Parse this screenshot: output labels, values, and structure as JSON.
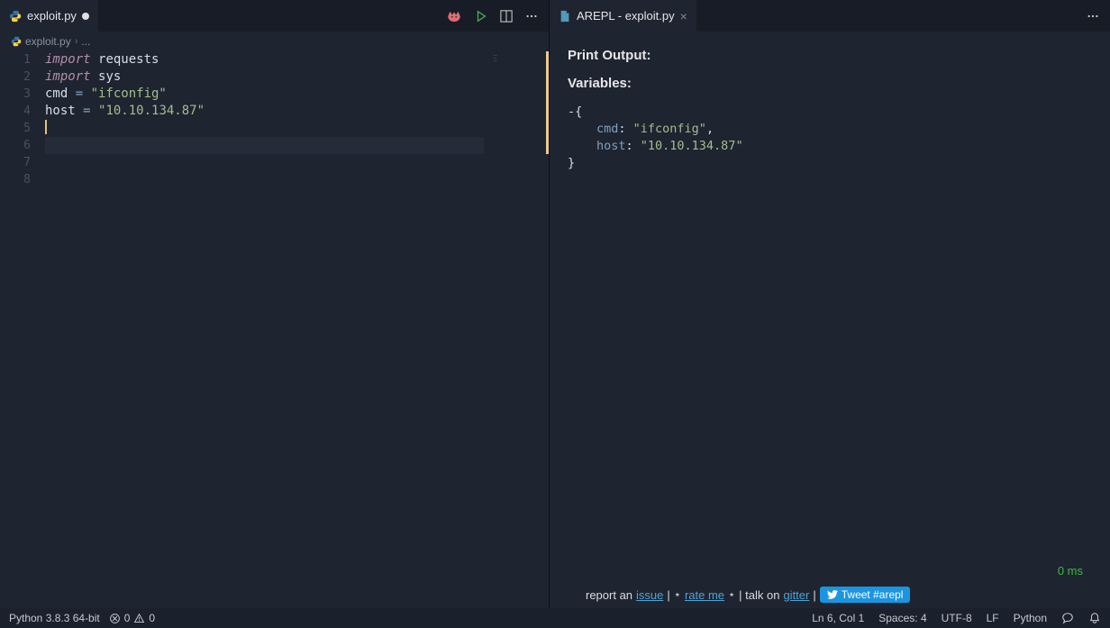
{
  "tabs": {
    "left": {
      "filename": "exploit.py",
      "dirty": true
    },
    "right": {
      "title": "AREPL - exploit.py",
      "dirty": false
    }
  },
  "breadcrumb": {
    "file": "exploit.py",
    "rest": "..."
  },
  "code": {
    "line_numbers": [
      "1",
      "2",
      "3",
      "4",
      "5",
      "6",
      "7",
      "8"
    ],
    "tokens": [
      [
        {
          "t": "import ",
          "c": "kw-import"
        },
        {
          "t": "requests",
          "c": "ident"
        }
      ],
      [
        {
          "t": "import ",
          "c": "kw-import"
        },
        {
          "t": "sys",
          "c": "ident"
        }
      ],
      [
        {
          "t": "",
          "c": "ident"
        }
      ],
      [
        {
          "t": "cmd ",
          "c": "ident"
        },
        {
          "t": "= ",
          "c": "op"
        },
        {
          "t": "\"ifconfig\"",
          "c": "str"
        }
      ],
      [
        {
          "t": "host ",
          "c": "ident"
        },
        {
          "t": "= ",
          "c": "op"
        },
        {
          "t": "\"10.10.134.87\"",
          "c": "str"
        }
      ],
      [
        {
          "t": "",
          "c": "ident",
          "cursor": true
        }
      ],
      [
        {
          "t": "",
          "c": "ident"
        }
      ],
      [
        {
          "t": "",
          "c": "ident"
        }
      ]
    ],
    "current_line_index": 5
  },
  "arepl": {
    "print_heading": "Print Output:",
    "vars_heading": "Variables:",
    "vars": {
      "cmd": "\"ifconfig\"",
      "host": "\"10.10.134.87\""
    },
    "timing": "0 ms",
    "footer": {
      "prefix": "report an ",
      "issue": "issue",
      "sep1": " | ",
      "star": "⋆",
      "rate": "rate me",
      "sep2": " | talk on ",
      "gitter": "gitter",
      "sep3": " | ",
      "tweet": "Tweet #arepl"
    }
  },
  "status": {
    "python": "Python 3.8.3 64-bit",
    "errors": "0",
    "warnings": "0",
    "position": "Ln 6, Col 1",
    "spaces": "Spaces: 4",
    "encoding": "UTF-8",
    "eol": "LF",
    "lang": "Python"
  }
}
